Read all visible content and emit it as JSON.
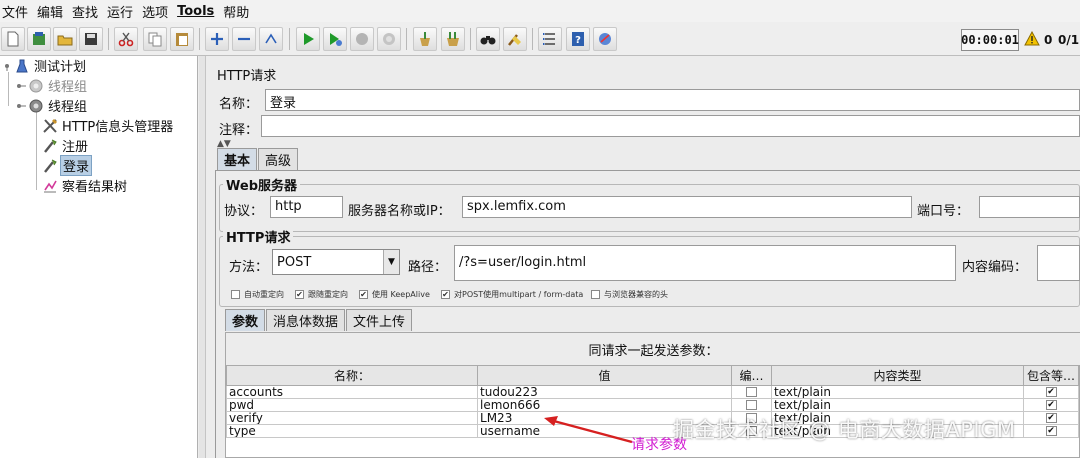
{
  "menu": [
    "文件",
    "编辑",
    "查找",
    "运行",
    "选项",
    "Tools",
    "帮助"
  ],
  "toolbar": {
    "buttons": [
      "new-icon",
      "templates-icon",
      "open-icon",
      "save-icon",
      "cut-icon",
      "copy-icon",
      "paste-icon",
      "expand-icon",
      "collapse-icon",
      "toggle-icon",
      "start-icon",
      "start-no-pause-icon",
      "stop-icon",
      "shutdown-icon",
      "clear-icon",
      "clear-all-icon",
      "search-icon",
      "reset-search-icon",
      "function-helper-icon",
      "help-icon",
      "remote-icon"
    ],
    "timer": "00:00:01",
    "warnings": "0",
    "threads": "0/1"
  },
  "tree": {
    "items": [
      {
        "label": "测试计划",
        "icon": "test-plan-icon"
      },
      {
        "label": "线程组",
        "icon": "thread-group-icon",
        "disabled": true
      },
      {
        "label": "线程组",
        "icon": "thread-group-icon"
      },
      {
        "label": "HTTP信息头管理器",
        "icon": "header-manager-icon"
      },
      {
        "label": "注册",
        "icon": "sampler-icon"
      },
      {
        "label": "登录",
        "icon": "sampler-icon",
        "selected": true
      },
      {
        "label": "察看结果树",
        "icon": "listener-icon"
      }
    ]
  },
  "panel": {
    "title": "HTTP请求",
    "name_label": "名称：",
    "name_value": "登录",
    "comment_label": "注释：",
    "comment_value": "",
    "tabs": [
      "基本",
      "高级"
    ],
    "web_server": {
      "legend": "Web服务器",
      "protocol_label": "协议：",
      "protocol_value": "http",
      "server_label": "服务器名称或IP：",
      "server_value": "spx.lemfix.com",
      "port_label": "端口号："
    },
    "http_request": {
      "legend": "HTTP请求",
      "method_label": "方法：",
      "method_value": "POST",
      "path_label": "路径：",
      "path_value": "/?s=user/login.html",
      "encoding_label": "内容编码："
    },
    "options": [
      {
        "label": "自动重定向",
        "checked": false
      },
      {
        "label": "跟随重定向",
        "checked": true
      },
      {
        "label": "使用 KeepAlive",
        "checked": true
      },
      {
        "label": "对POST使用multipart / form-data",
        "checked": true
      },
      {
        "label": "与浏览器兼容的头",
        "checked": false
      }
    ],
    "sub_tabs": [
      "参数",
      "消息体数据",
      "文件上传"
    ],
    "params_caption": "同请求一起发送参数：",
    "columns": [
      "名称：",
      "值",
      "编…",
      "内容类型",
      "包含等…"
    ],
    "params": [
      {
        "name": "accounts",
        "value": "tudou223",
        "encode": false,
        "content_type": "text/plain",
        "include_equals": true
      },
      {
        "name": "pwd",
        "value": "lemon666",
        "encode": false,
        "content_type": "text/plain",
        "include_equals": true
      },
      {
        "name": "verify",
        "value": "LM23",
        "encode": false,
        "content_type": "text/plain",
        "include_equals": true
      },
      {
        "name": "type",
        "value": "username",
        "encode": false,
        "content_type": "text/plain",
        "include_equals": true
      }
    ]
  },
  "annotation": {
    "note": "请求参数",
    "color": "#d21cd2"
  },
  "watermark": "掘金技术社区 @ 电商大数据APIGM"
}
